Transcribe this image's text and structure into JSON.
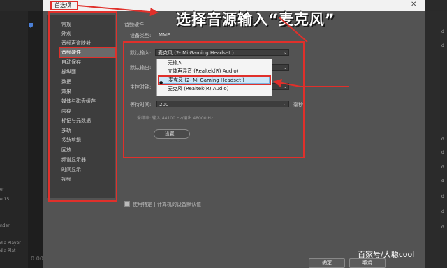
{
  "dialog": {
    "title": "首选项"
  },
  "annotation": {
    "text": "选择音源输入“麦克风”"
  },
  "background_left": {
    "lines": [
      "er",
      "e 15",
      "nder",
      "dia Player",
      "dia Plat"
    ],
    "timecode": "0:00:0"
  },
  "background_right": {
    "letters": [
      "d",
      "d",
      "d",
      "d",
      "d",
      "d",
      "d",
      "d",
      "d"
    ]
  },
  "sidebar": {
    "items": [
      "常规",
      "外观",
      "音频声道映射",
      "音频硬件",
      "自动保存",
      "操纵面",
      "数据",
      "效果",
      "媒体与磁盘缓存",
      "内存",
      "标记与元数据",
      "多轨",
      "多轨剪辑",
      "回放",
      "频谱显示器",
      "时间显示",
      "视频"
    ],
    "selected_index": 3
  },
  "audio_hardware": {
    "section_title": "音频硬件",
    "device_type_label": "设备类型:",
    "device_type_value": "MME",
    "default_input_label": "默认输入:",
    "default_input_value": "麦克风 (2- Mi Gaming Headset )",
    "default_output_label": "默认输出:",
    "master_clock_label": "主控时钟:",
    "latency_label": "等待时间:",
    "latency_value": "200",
    "latency_unit": "毫秒",
    "sample_rate_text": "采样率: 输入 44100 Hz/输出 48000 Hz",
    "settings_button": "设置..."
  },
  "dropdown": {
    "options": [
      "无输入",
      "立体声混音 (Realtek(R) Audio)",
      "麦克风 (2- Mi Gaming Headset )",
      "麦克风 (Realtek(R) Audio)"
    ],
    "selected_index": 2
  },
  "checkbox": {
    "label": "使用特定于计算机的设备默认值",
    "checked": true
  },
  "buttons": {
    "ok": "确定",
    "cancel": "取消"
  },
  "watermark": {
    "text": "百家号/大聪cool"
  },
  "colors": {
    "accent_red": "#e0302b",
    "dialog_bg": "#535353",
    "sidebar_bg": "#3d3d3d",
    "highlight": "#cde6f7"
  }
}
